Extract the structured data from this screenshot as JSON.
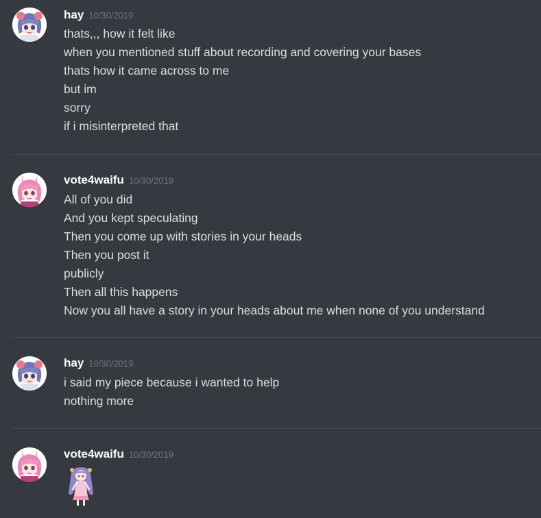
{
  "messages": [
    {
      "username": "hay",
      "timestamp": "10/30/2019",
      "avatar_icon": "blue-haired-anime-avatar",
      "lines": [
        "thats,,, how it felt like",
        "when you mentioned stuff about recording and covering your bases",
        "thats how it came across to me",
        "but im",
        "sorry",
        "if i misinterpreted that"
      ]
    },
    {
      "username": "vote4waifu",
      "timestamp": "10/30/2019",
      "avatar_icon": "pink-haired-anime-avatar",
      "lines": [
        "All of you did",
        "And you kept speculating",
        "Then you come up with stories in your heads",
        "Then you post it",
        "publicly",
        "Then all this happens",
        "Now you all have a story in your heads about me when none of you understand"
      ]
    },
    {
      "username": "hay",
      "timestamp": "10/30/2019",
      "avatar_icon": "blue-haired-anime-avatar",
      "lines": [
        "i said my piece because i wanted to help",
        "nothing more"
      ]
    },
    {
      "username": "vote4waifu",
      "timestamp": "10/30/2019",
      "avatar_icon": "pink-haired-anime-avatar",
      "attachment_icon": "anime-girl-sticker",
      "lines": []
    }
  ],
  "colors": {
    "background": "#36393f",
    "username": "#ffffff",
    "timestamp": "#72767d",
    "message_text": "#dcddde",
    "divider": "#42454a"
  }
}
